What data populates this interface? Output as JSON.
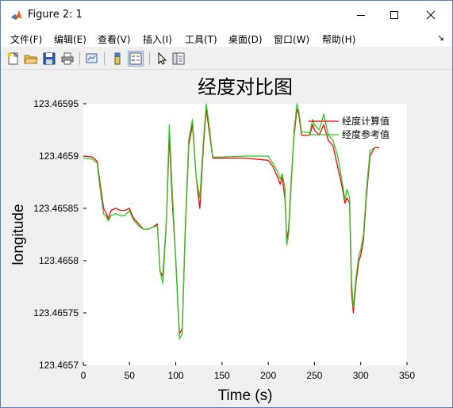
{
  "window": {
    "title": "Figure 2: 1",
    "controls": {
      "minimize": "minimize",
      "maximize": "maximize",
      "close": "close"
    }
  },
  "menu": {
    "items": [
      {
        "label": "文件(F)"
      },
      {
        "label": "编辑(E)"
      },
      {
        "label": "查看(V)"
      },
      {
        "label": "插入(I)"
      },
      {
        "label": "工具(T)"
      },
      {
        "label": "桌面(D)"
      },
      {
        "label": "窗口(W)"
      },
      {
        "label": "帮助(H)"
      }
    ],
    "overflow_icon": "chevron-icon"
  },
  "toolbar": {
    "icons": [
      "new-figure-icon",
      "open-file-icon",
      "save-icon",
      "print-icon",
      "link-plot-icon",
      "colorbar-icon",
      "legend-icon",
      "pointer-icon",
      "property-editor-icon"
    ]
  },
  "chart_data": {
    "type": "line",
    "title": "经度对比图",
    "xlabel": "Time (s)",
    "ylabel": "longitude",
    "xlim": [
      0,
      350
    ],
    "ylim": [
      123.4657,
      123.46595
    ],
    "xticks": [
      "0",
      "50",
      "100",
      "150",
      "200",
      "250",
      "300",
      "350"
    ],
    "yticks": [
      "123.4657",
      "123.46575",
      "123.4658",
      "123.46585",
      "123.4659",
      "123.46595"
    ],
    "grid": false,
    "legend_position": "top-right",
    "series": [
      {
        "name": "经度计算值",
        "color": "#ff0000",
        "x": [
          0,
          10,
          15,
          18,
          22,
          25,
          27,
          30,
          35,
          40,
          45,
          50,
          52,
          55,
          60,
          65,
          70,
          75,
          80,
          83,
          86,
          90,
          93,
          96,
          100,
          104,
          107,
          110,
          114,
          118,
          122,
          126,
          130,
          133,
          136,
          140,
          150,
          175,
          200,
          205,
          210,
          213,
          215,
          218,
          220,
          222,
          225,
          228,
          231,
          233,
          236,
          240,
          245,
          248,
          250,
          255,
          260,
          265,
          270,
          275,
          280,
          283,
          285,
          288,
          290,
          292,
          295,
          298,
          300,
          303,
          306,
          310,
          315,
          320
        ],
        "y": [
          123.4659,
          123.465899,
          123.465895,
          123.465875,
          123.46585,
          123.465845,
          123.46584,
          123.465848,
          123.46585,
          123.465848,
          123.465848,
          123.46585,
          123.465845,
          123.46584,
          123.465835,
          123.46583,
          123.46583,
          123.465832,
          123.465835,
          123.46579,
          123.465785,
          123.46584,
          123.46592,
          123.46586,
          123.4658,
          123.46573,
          123.465735,
          123.46582,
          123.46591,
          123.46593,
          123.46588,
          123.46585,
          123.46591,
          123.465945,
          123.465925,
          123.465898,
          123.465898,
          123.465898,
          123.465896,
          123.46589,
          123.46588,
          123.465873,
          123.46588,
          123.46586,
          123.46582,
          123.46583,
          123.46588,
          123.46592,
          123.465945,
          123.46594,
          123.46592,
          123.46592,
          123.46592,
          123.46593,
          123.465925,
          123.46592,
          123.46593,
          123.465915,
          123.46591,
          123.46589,
          123.46587,
          123.465855,
          123.46586,
          123.465855,
          123.46577,
          123.46575,
          123.46578,
          123.4658,
          123.465805,
          123.46582,
          123.46586,
          123.4659,
          123.465908,
          123.465908
        ]
      },
      {
        "name": "经度参考值",
        "color": "#22cc22",
        "x": [
          0,
          10,
          15,
          18,
          22,
          25,
          27,
          30,
          35,
          40,
          45,
          50,
          52,
          55,
          60,
          65,
          70,
          75,
          80,
          83,
          86,
          90,
          93,
          96,
          100,
          104,
          107,
          110,
          114,
          118,
          122,
          126,
          130,
          133,
          136,
          140,
          150,
          175,
          200,
          205,
          210,
          213,
          215,
          218,
          220,
          222,
          225,
          228,
          231,
          233,
          236,
          240,
          245,
          248,
          250,
          255,
          260,
          265,
          270,
          275,
          280,
          283,
          285,
          288,
          290,
          292,
          295,
          298,
          300,
          303,
          306,
          310,
          315
        ],
        "y": [
          123.465898,
          123.465897,
          123.465893,
          123.46587,
          123.465845,
          123.465842,
          123.465838,
          123.465843,
          123.465845,
          123.465843,
          123.465843,
          123.465848,
          123.465843,
          123.465838,
          123.465833,
          123.46583,
          123.46583,
          123.465832,
          123.465833,
          123.46579,
          123.465778,
          123.46584,
          123.46593,
          123.46587,
          123.4658,
          123.465725,
          123.46573,
          123.465825,
          123.465915,
          123.465935,
          123.46588,
          123.46586,
          123.465915,
          123.46595,
          123.46593,
          123.465899,
          123.465899,
          123.4659,
          123.4659,
          123.465893,
          123.465885,
          123.465878,
          123.465883,
          123.46587,
          123.465815,
          123.465825,
          123.465875,
          123.465925,
          123.46595,
          123.465943,
          123.465923,
          123.465923,
          123.465922,
          123.465935,
          123.46593,
          123.465925,
          123.46594,
          123.46592,
          123.465915,
          123.4659,
          123.465875,
          123.465858,
          123.465868,
          123.46586,
          123.46578,
          123.465755,
          123.465785,
          123.465805,
          123.46581,
          123.465825,
          123.465865,
          123.465905,
          123.465908
        ]
      }
    ]
  }
}
